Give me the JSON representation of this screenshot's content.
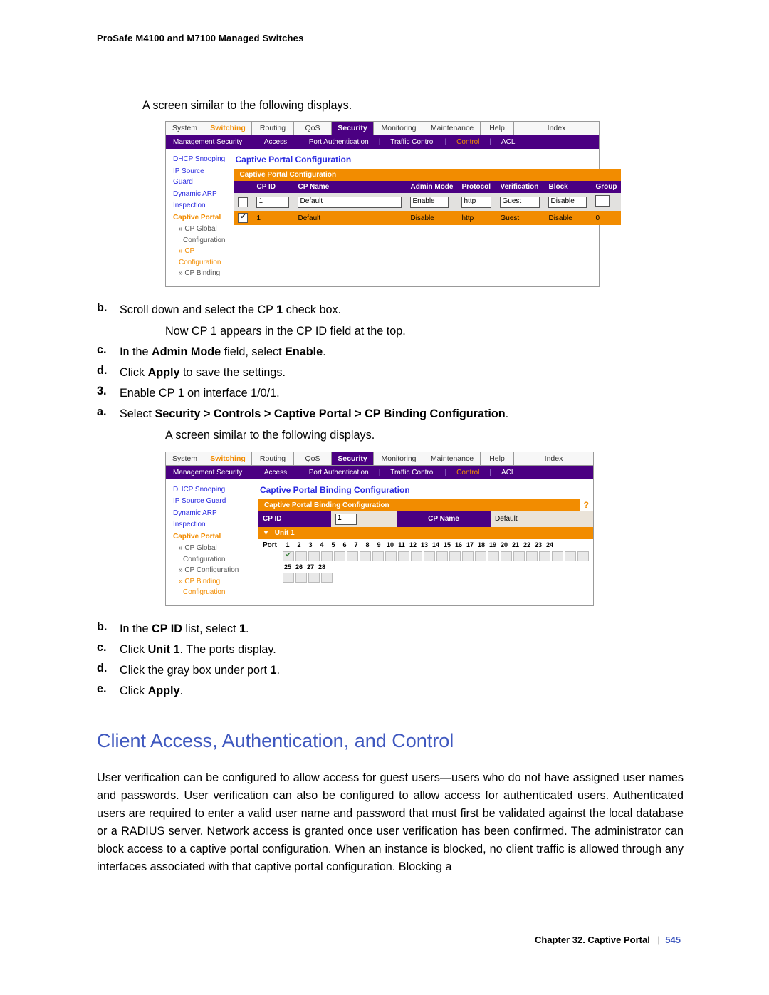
{
  "doc_header": "ProSafe M4100 and M7100 Managed Switches",
  "intro_line": "A screen similar to the following displays.",
  "steps": {
    "b": {
      "label": "b.",
      "text_parts": [
        "Scroll down and select the CP ",
        "1",
        " check box."
      ]
    },
    "b_follow": "Now CP 1 appears in the CP ID field at the top.",
    "c": {
      "label": "c.",
      "text_parts": [
        "In the ",
        "Admin Mode",
        " field, select ",
        "Enable",
        "."
      ]
    },
    "d": {
      "label": "d.",
      "text_parts": [
        "Click ",
        "Apply",
        " to save the settings."
      ]
    },
    "s3": {
      "label": "3.",
      "text": "Enable CP 1 on interface 1/0/1."
    },
    "a2": {
      "label": "a.",
      "text_parts": [
        "Select ",
        "Security > Controls > Captive Portal > CP Binding Configuration",
        "."
      ]
    },
    "a2_follow": "A screen similar to the following displays.",
    "b2": {
      "label": "b.",
      "text_parts": [
        "In the ",
        "CP ID",
        " list, select ",
        "1",
        "."
      ]
    },
    "c2": {
      "label": "c.",
      "text_parts": [
        "Click ",
        "Unit 1",
        ". The ports display."
      ]
    },
    "d2": {
      "label": "d.",
      "text_parts": [
        "Click the gray box under port ",
        "1",
        "."
      ]
    },
    "e2": {
      "label": "e.",
      "text_parts": [
        "Click ",
        "Apply",
        "."
      ]
    }
  },
  "section_h2": "Client Access, Authentication, and Control",
  "section_para": "User verification can be configured to allow access for guest users—users who do not have assigned user names and passwords. User verification can also be configured to allow access for authenticated users. Authenticated users are required to enter a valid user name and password that must first be validated against the local database or a RADIUS server. Network access is granted once user verification has been confirmed. The administrator can block access to a captive portal configuration. When an instance is blocked, no client traffic is allowed through any interfaces associated with that captive portal configuration. Blocking a",
  "footer": {
    "chapter": "Chapter 32.  Captive Portal",
    "sep": "|",
    "page": "545"
  },
  "ui_common": {
    "tabs": {
      "system": "System",
      "switching": "Switching",
      "routing": "Routing",
      "qos": "QoS",
      "security": "Security",
      "monitoring": "Monitoring",
      "maintenance": "Maintenance",
      "help": "Help",
      "index": "Index"
    },
    "subtabs": {
      "mgmt": "Management Security",
      "access": "Access",
      "portauth": "Port Authentication",
      "traffic": "Traffic Control",
      "control": "Control",
      "acl": "ACL"
    },
    "side": {
      "dhcp": "DHCP Snooping",
      "ipsg": "IP Source Guard",
      "darp": "Dynamic ARP",
      "insp": "Inspection",
      "cportal": "Captive Portal",
      "cpglobal": "» CP Global",
      "cpconf": "Configuration",
      "cpconf_link": "» CP Configuration",
      "cpbind": "» CP Binding",
      "cpbindconf": "Configruation"
    }
  },
  "ui1": {
    "title": "Captive Portal Configuration",
    "section_bar": "Captive Portal Configuration",
    "headers": {
      "cpid": "CP ID",
      "cpname": "CP Name",
      "admin": "Admin Mode",
      "proto": "Protocol",
      "verif": "Verification",
      "block": "Block",
      "group": "Group"
    },
    "row_input": {
      "cpid": "1",
      "cpname": "Default",
      "admin": "Enable",
      "proto": "http",
      "verif": "Guest",
      "block": "Disable",
      "group": ""
    },
    "row_selected": {
      "cpid": "1",
      "cpname": "Default",
      "admin": "Disable",
      "proto": "http",
      "verif": "Guest",
      "block": "Disable",
      "group": "0"
    }
  },
  "ui2": {
    "title": "Captive Portal Binding Configuration",
    "section_bar": "Captive Portal Binding Configuration",
    "cpid_label": "CP ID",
    "cpid_value": "1",
    "cpname_label": "CP Name",
    "cpname_value": "Default",
    "unit_label": "Unit 1",
    "port_label": "Port",
    "port_row1": [
      "1",
      "2",
      "3",
      "4",
      "5",
      "6",
      "7",
      "8",
      "9",
      "10",
      "11",
      "12",
      "13",
      "14",
      "15",
      "16",
      "17",
      "18",
      "19",
      "20",
      "21",
      "22",
      "23",
      "24"
    ],
    "port_row2": [
      "25",
      "26",
      "27",
      "28"
    ]
  }
}
